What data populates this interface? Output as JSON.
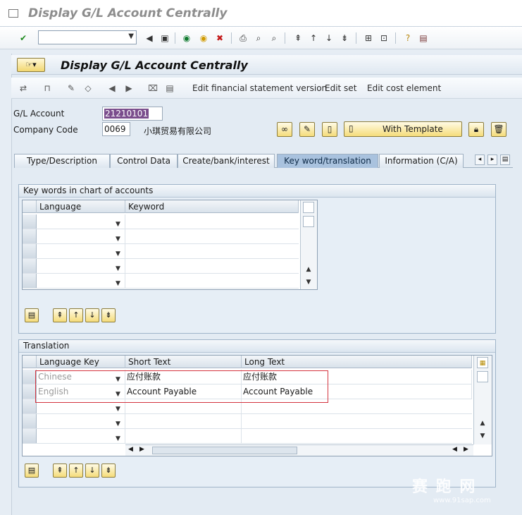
{
  "window": {
    "title": "Display G/L Account Centrally"
  },
  "screen": {
    "title": "Display G/L Account Centrally"
  },
  "app_toolbar": {
    "edit_fsv": "Edit financial statement version",
    "edit_set": "Edit set",
    "edit_cost_element": "Edit cost element"
  },
  "header": {
    "gl_account_label": "G/L Account",
    "gl_account_value": "21210101",
    "company_code_label": "Company Code",
    "company_code_value": "0069",
    "company_name": "小琪贸易有限公司",
    "with_template": "With Template"
  },
  "tabs": [
    {
      "label": "Type/Description"
    },
    {
      "label": "Control Data"
    },
    {
      "label": "Create/bank/interest"
    },
    {
      "label": "Key word/translation"
    },
    {
      "label": "Information (C/A)"
    }
  ],
  "keywords_group": {
    "title": "Key words in chart of accounts",
    "columns": [
      "Language",
      "Keyword"
    ]
  },
  "translation_group": {
    "title": "Translation",
    "columns": [
      "Language Key",
      "Short Text",
      "Long Text"
    ],
    "rows": [
      {
        "lang": "Chinese",
        "short": "应付账款",
        "long": "应付账款"
      },
      {
        "lang": "English",
        "short": "Account Payable",
        "long": "Account Payable"
      }
    ]
  },
  "watermark": {
    "text": "赛 跑 网",
    "url": "www.91sap.com"
  }
}
